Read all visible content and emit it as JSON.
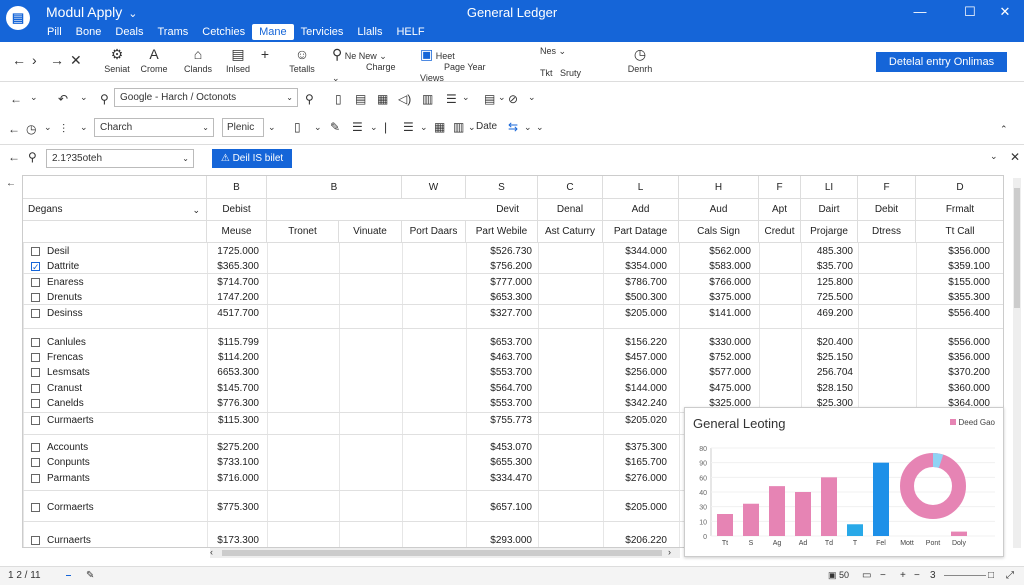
{
  "window": {
    "app_name": "Modul Apply",
    "title": "General Ledger",
    "min": "—",
    "max": "☐",
    "close": "✕"
  },
  "menu": [
    "Pill",
    "Bone",
    "Deals",
    "Trams",
    "Cetchies",
    "Mane",
    "Tervicies",
    "Llalls",
    "HELF"
  ],
  "ribbon": {
    "buttons": [
      {
        "icon": "⚙",
        "label": "Seniat"
      },
      {
        "icon": "A",
        "label": "Crome"
      },
      {
        "icon": "⌂",
        "label": "Clands"
      },
      {
        "icon": "▤",
        "label": "Inlsed"
      },
      {
        "icon": "+",
        "label": ""
      },
      {
        "icon": "☺",
        "label": "Tetalls"
      },
      {
        "icon": "⚲",
        "label": "Ne New"
      },
      {
        "icon": "",
        "label": "Charge"
      },
      {
        "icon": "▣",
        "label": "Page Year"
      },
      {
        "icon": "Heet",
        "label": "Views"
      },
      {
        "icon": "Nes",
        "label": "Tkt"
      },
      {
        "icon": "",
        "label": "Sruty"
      },
      {
        "icon": "◷",
        "label": "Denrh"
      }
    ],
    "cta": "Detelal entry Onlimas"
  },
  "toolbar2": {
    "search_value": "Google - Harch / Octonots"
  },
  "toolbar3": {
    "font_value": "Charch",
    "style_value": "Plenic",
    "date_label": "Date"
  },
  "filter": {
    "search_value": "2.1?35oteh",
    "button": "Deil IS bilet"
  },
  "grid": {
    "top_headers": [
      "B",
      "B",
      "W",
      "S",
      "C",
      "L",
      "H",
      "F",
      "LI",
      "F",
      "D"
    ],
    "first_col_label": "Degans",
    "sub_headers": [
      "Debist",
      "Devit",
      "Denal",
      "Add",
      "Aud",
      "Apt",
      "Dairt",
      "Debit",
      "Frmalt"
    ],
    "sub2_headers": [
      "Meuse",
      "Tronet",
      "Vinuate",
      "Port Daars",
      "Part Webile",
      "Ast Caturry",
      "Part Datage",
      "Cals Sign",
      "Credut",
      "Projarge",
      "Dtress",
      "Tt Call"
    ],
    "rows": [
      {
        "name": "Desil",
        "checked": false,
        "v": [
          "1725.000",
          "$526.730",
          "$344.000",
          "$562.000",
          "485.300",
          "$356.000"
        ]
      },
      {
        "name": "Dattrite",
        "checked": true,
        "v": [
          "$365.300",
          "$756.200",
          "$354.000",
          "$583.000",
          "$35.700",
          "$359.100"
        ]
      },
      {
        "name": "Enaress",
        "checked": false,
        "v": [
          "$714.700",
          "$777.000",
          "$786.700",
          "$766.000",
          "125.800",
          "$155.000"
        ]
      },
      {
        "name": "Drenuts",
        "checked": false,
        "v": [
          "1747.200",
          "$653.300",
          "$500.300",
          "$375.000",
          "725.500",
          "$355.300"
        ]
      },
      {
        "name": "Desinss",
        "checked": false,
        "v": [
          "4517.700",
          "$327.700",
          "$205.000",
          "$141.000",
          "469.200",
          "$556.400"
        ]
      },
      {
        "name": "Canlules",
        "checked": false,
        "v": [
          "$115.799",
          "$653.700",
          "$156.220",
          "$330.000",
          "$20.400",
          "$556.000"
        ]
      },
      {
        "name": "Frencas",
        "checked": false,
        "v": [
          "$114.200",
          "$463.700",
          "$457.000",
          "$752.000",
          "$25.150",
          "$356.000"
        ]
      },
      {
        "name": "Lesmsats",
        "checked": false,
        "v": [
          "6653.300",
          "$553.700",
          "$256.000",
          "$577.000",
          "256.704",
          "$370.200"
        ]
      },
      {
        "name": "Cranust",
        "checked": false,
        "v": [
          "$145.700",
          "$564.700",
          "$144.000",
          "$475.000",
          "$28.150",
          "$360.000"
        ]
      },
      {
        "name": "Canelds",
        "checked": false,
        "v": [
          "$776.300",
          "$553.700",
          "$342.240",
          "$325.000",
          "$25.300",
          "$364.000"
        ]
      },
      {
        "name": "Curmaerts",
        "checked": false,
        "v": [
          "$115.300",
          "$755.773",
          "$205.020",
          "",
          "",
          ""
        ]
      },
      {
        "name": "Accounts",
        "checked": false,
        "v": [
          "$275.200",
          "$453.070",
          "$375.300",
          "",
          "",
          ""
        ]
      },
      {
        "name": "Conpunts",
        "checked": false,
        "v": [
          "$733.100",
          "$655.300",
          "$165.700",
          "",
          "",
          ""
        ]
      },
      {
        "name": "Parmants",
        "checked": false,
        "v": [
          "$716.000",
          "$334.470",
          "$276.000",
          "",
          "",
          ""
        ]
      },
      {
        "name": "Cormaerts",
        "checked": false,
        "v": [
          "$775.300",
          "$657.100",
          "$205.000",
          "",
          "",
          ""
        ]
      },
      {
        "name": "Curnaerts",
        "checked": false,
        "v": [
          "$173.300",
          "$293.000",
          "$206.220",
          "",
          "",
          ""
        ]
      }
    ]
  },
  "chart": {
    "title": "General Leoting",
    "legend": "Deed Gao"
  },
  "chart_data": {
    "type": "bar",
    "title": "General Leoting",
    "y_ticks": [
      "80",
      "90",
      "60",
      "40",
      "30",
      "10",
      "0"
    ],
    "categories": [
      "Tt",
      "S",
      "Ag",
      "Ad",
      "Td",
      "T",
      "Fel",
      "Mott",
      "Pont",
      "Doly"
    ],
    "values": [
      15,
      22,
      34,
      30,
      40,
      8,
      50,
      0,
      0,
      3
    ],
    "series": [
      {
        "name": "Deed Gao",
        "color": "#e684b4"
      }
    ],
    "highlight_colors": {
      "T": "#29a9e8",
      "Fel": "#1e90e8"
    },
    "donut": {
      "pink": 0.95,
      "blue": 0.05
    }
  },
  "status": {
    "left": "1 2 / 11",
    "right": "3"
  }
}
